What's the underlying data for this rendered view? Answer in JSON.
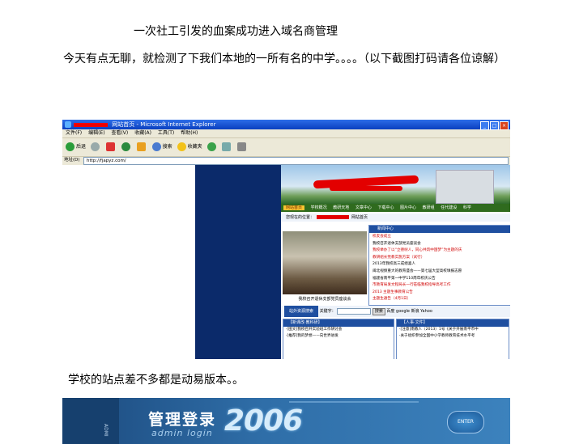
{
  "article": {
    "title": "一次社工引发的血案成功进入域名商管理",
    "paragraph1": "今天有点无聊，就检测了下我们本地的一所有名的中学。。。。（以下截图打码请各位谅解）",
    "paragraph2": "学校的站点差不多都是动易版本。。"
  },
  "screenshot": {
    "window_title": "网站首页 - Microsoft Internet Explorer",
    "menu": [
      "文件(F)",
      "编辑(E)",
      "查看(V)",
      "收藏(A)",
      "工具(T)",
      "帮助(H)"
    ],
    "toolbar": [
      {
        "label": "后退",
        "icon": "back-icon",
        "color": "#2a9d3a"
      },
      {
        "label": "",
        "icon": "forward-icon",
        "color": "#9aa"
      },
      {
        "label": "",
        "icon": "stop-icon",
        "color": "#d33"
      },
      {
        "label": "",
        "icon": "refresh-icon",
        "color": "#2b8a3e"
      },
      {
        "label": "",
        "icon": "home-icon",
        "color": "#e9a020"
      },
      {
        "label": "搜索",
        "icon": "search-icon",
        "color": "#4a7bd0"
      },
      {
        "label": "收藏夹",
        "icon": "favorites-icon",
        "color": "#f2c21a"
      },
      {
        "label": "",
        "icon": "media-icon",
        "color": "#3aa24a"
      },
      {
        "label": "",
        "icon": "mail-icon",
        "color": "#7aa"
      },
      {
        "label": "",
        "icon": "print-icon",
        "color": "#888"
      }
    ],
    "address_label": "地址(D)",
    "address_value": "http://fjapyz.com/",
    "site": {
      "nav": [
        "网站首页",
        "学校概况",
        "教研天地",
        "文章中心",
        "下载中心",
        "图片中心",
        "教研组",
        "任代建设",
        "科学"
      ],
      "breadcrumb_prefix": "您现在的位置：",
      "breadcrumb_page": "网站首页",
      "news_title": "新闻中心",
      "news": [
        {
          "text": "校友会成立",
          "red": true
        },
        {
          "text": "我校召开退休支部党员座谈会",
          "red": false
        },
        {
          "text": "我校举办了以“立德树人，同心共筑中国梦”为主题的庆",
          "red": true
        },
        {
          "text": "教研组长党教实施方案（试行）",
          "red": true
        },
        {
          "text": "2013年我校高三成绩喜人",
          "red": false
        },
        {
          "text": "闽北视频重大的教育盛会——第七届大型高校填报志愿",
          "red": false
        },
        {
          "text": "福建省南平第一中学110周年校庆公告",
          "red": false
        },
        {
          "text": "市教育局发文程局长一行莅临我校指导高考工作",
          "red": true
        },
        {
          "text": "2013 主题生事教育公告",
          "red": true
        },
        {
          "text": "主题生通告（4月1日）",
          "red": true
        }
      ],
      "photo_caption": "我校召开退休支部党员座谈会",
      "search": {
        "title": "站外资源搜索",
        "keyword_label": "关键字：",
        "button": "搜索",
        "options": [
          "百度",
          "google",
          "新浪",
          "Yahoo"
        ]
      },
      "panel_left": {
        "title": "【新课改·教科研】",
        "items": [
          "·[图文]我校召开实验班工作研讨会",
          "·[推荐]我的梦想——向世界进发"
        ]
      },
      "panel_right": {
        "title": "【人事·文件】",
        "items": [
          "·[注意]南教人（2013）1号《关于开展南平市中",
          "·关于组织参加全国中小学教师教育技术水平考"
        ]
      }
    }
  },
  "admin_banner": {
    "heading": "管理登录",
    "sub": "admin login",
    "year": "2006",
    "enter": "ENTER",
    "side_text": "ADMI"
  }
}
